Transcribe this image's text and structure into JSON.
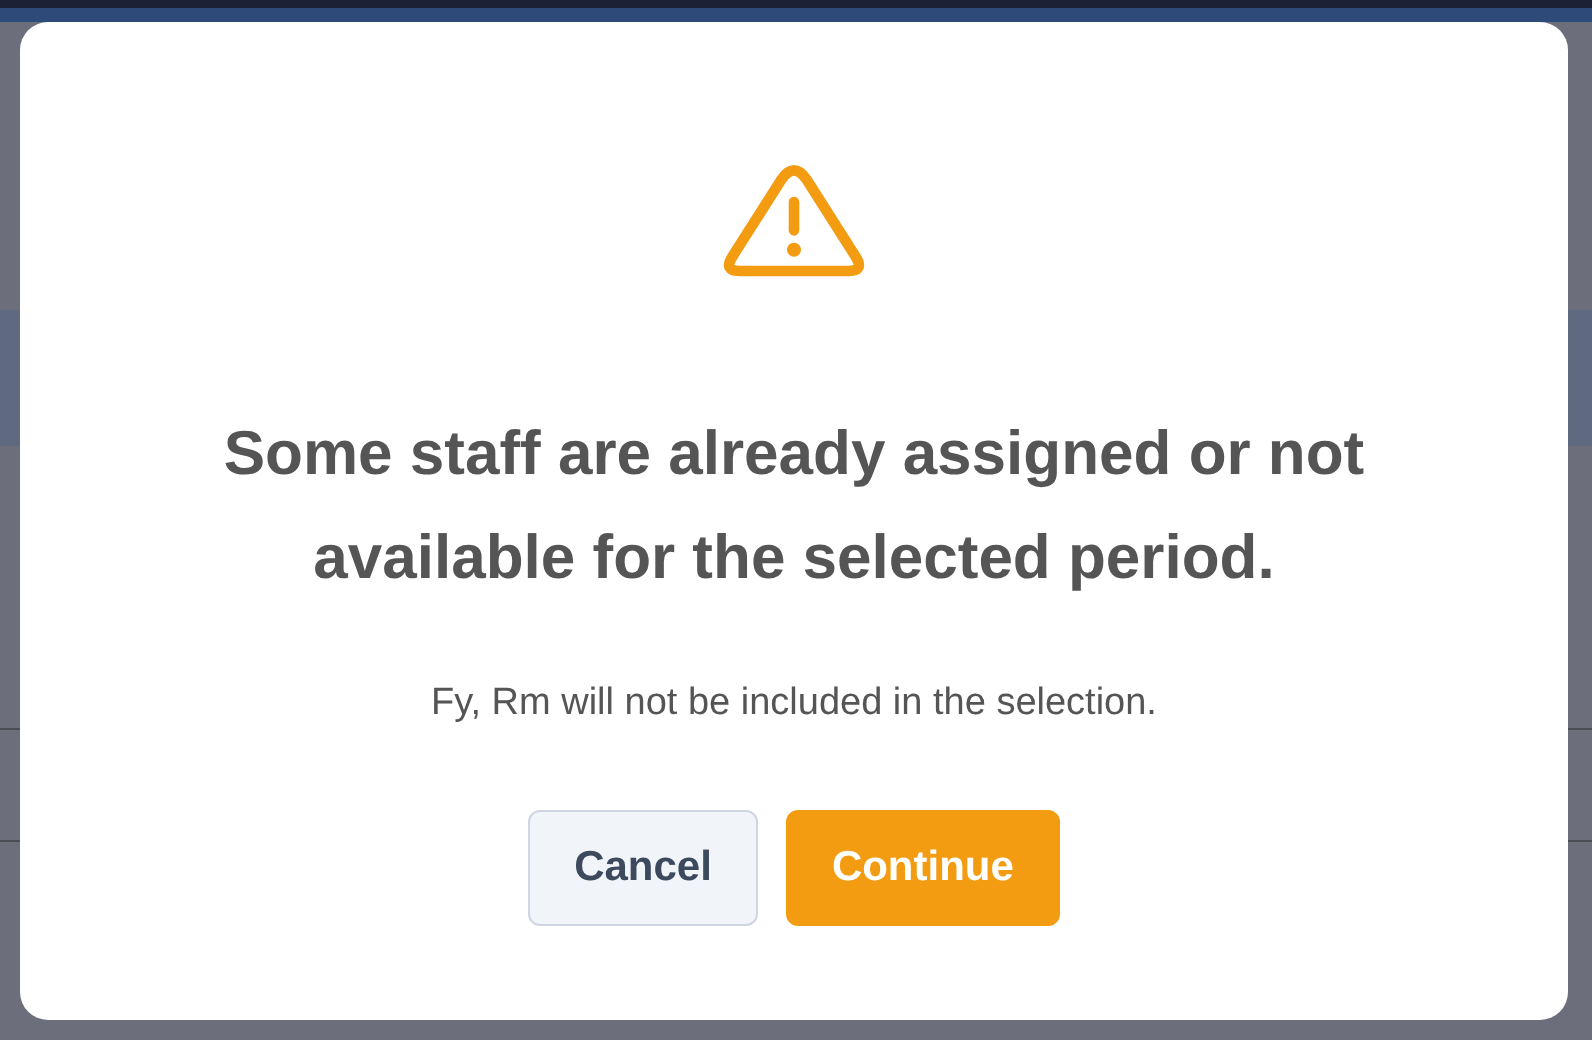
{
  "dialog": {
    "title": "Some staff are already assigned or not available for the selected period.",
    "message": "Fy, Rm will not be included in the selection.",
    "buttons": [
      {
        "label": "Cancel",
        "kind": "secondary"
      },
      {
        "label": "Continue",
        "kind": "primary"
      }
    ]
  }
}
